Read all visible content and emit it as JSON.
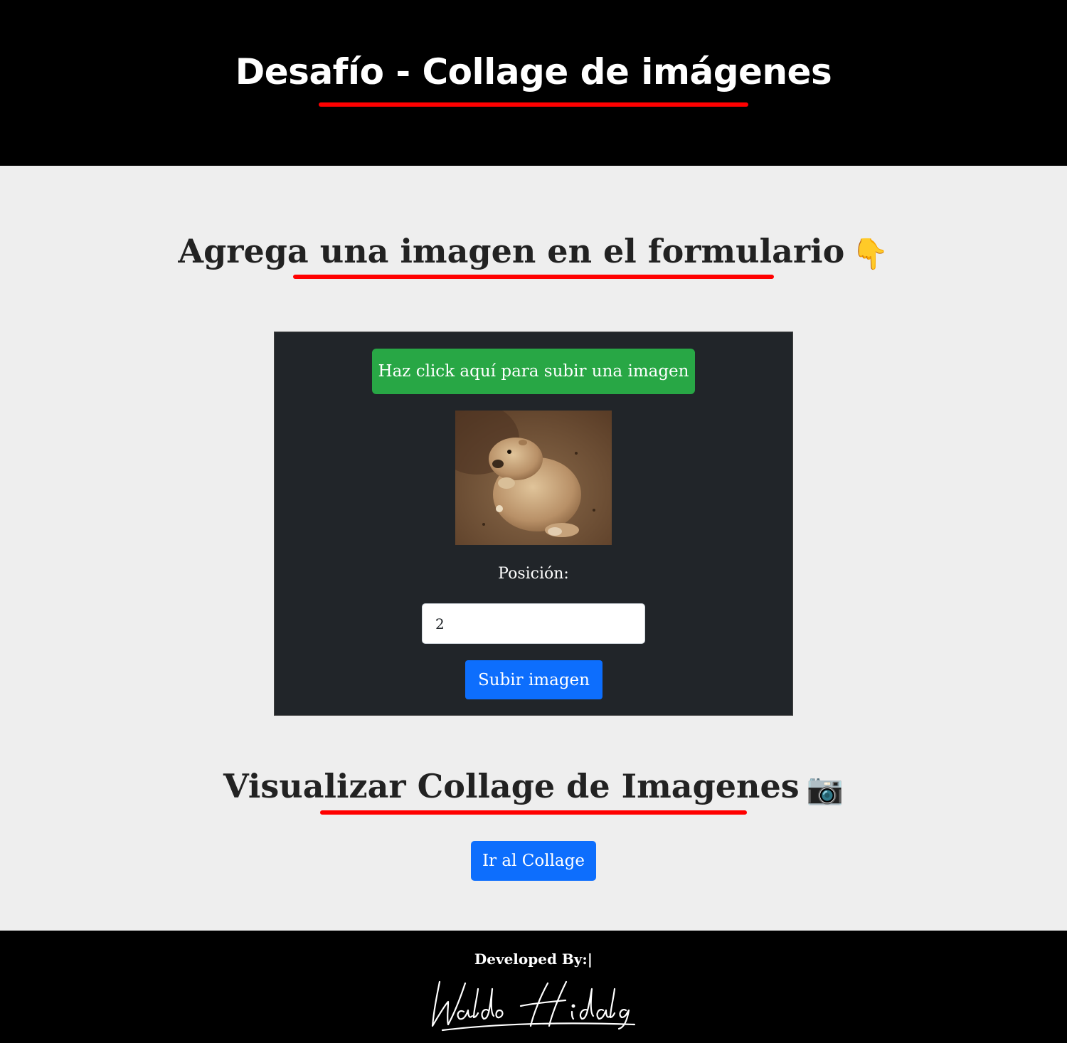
{
  "header": {
    "title": "Desafío - Collage de imágenes"
  },
  "upload_section": {
    "title": "Agrega una imagen en el formulario",
    "emoji": "👇",
    "upload_button_label": "Haz click aquí para subir una imagen",
    "position_label": "Posición:",
    "position_value": "2",
    "submit_button_label": "Subir imagen"
  },
  "collage_section": {
    "title": "Visualizar Collage de Imagenes",
    "emoji": "📷",
    "button_label": "Ir al Collage"
  },
  "footer": {
    "developed_by": "Developed By:|",
    "signature": "Waldo Hidalgo"
  },
  "colors": {
    "header_bg": "#000000",
    "accent_underline": "#ff0000",
    "upload_button": "#28a745",
    "primary_button": "#0d6efd",
    "card_bg": "#212529"
  }
}
